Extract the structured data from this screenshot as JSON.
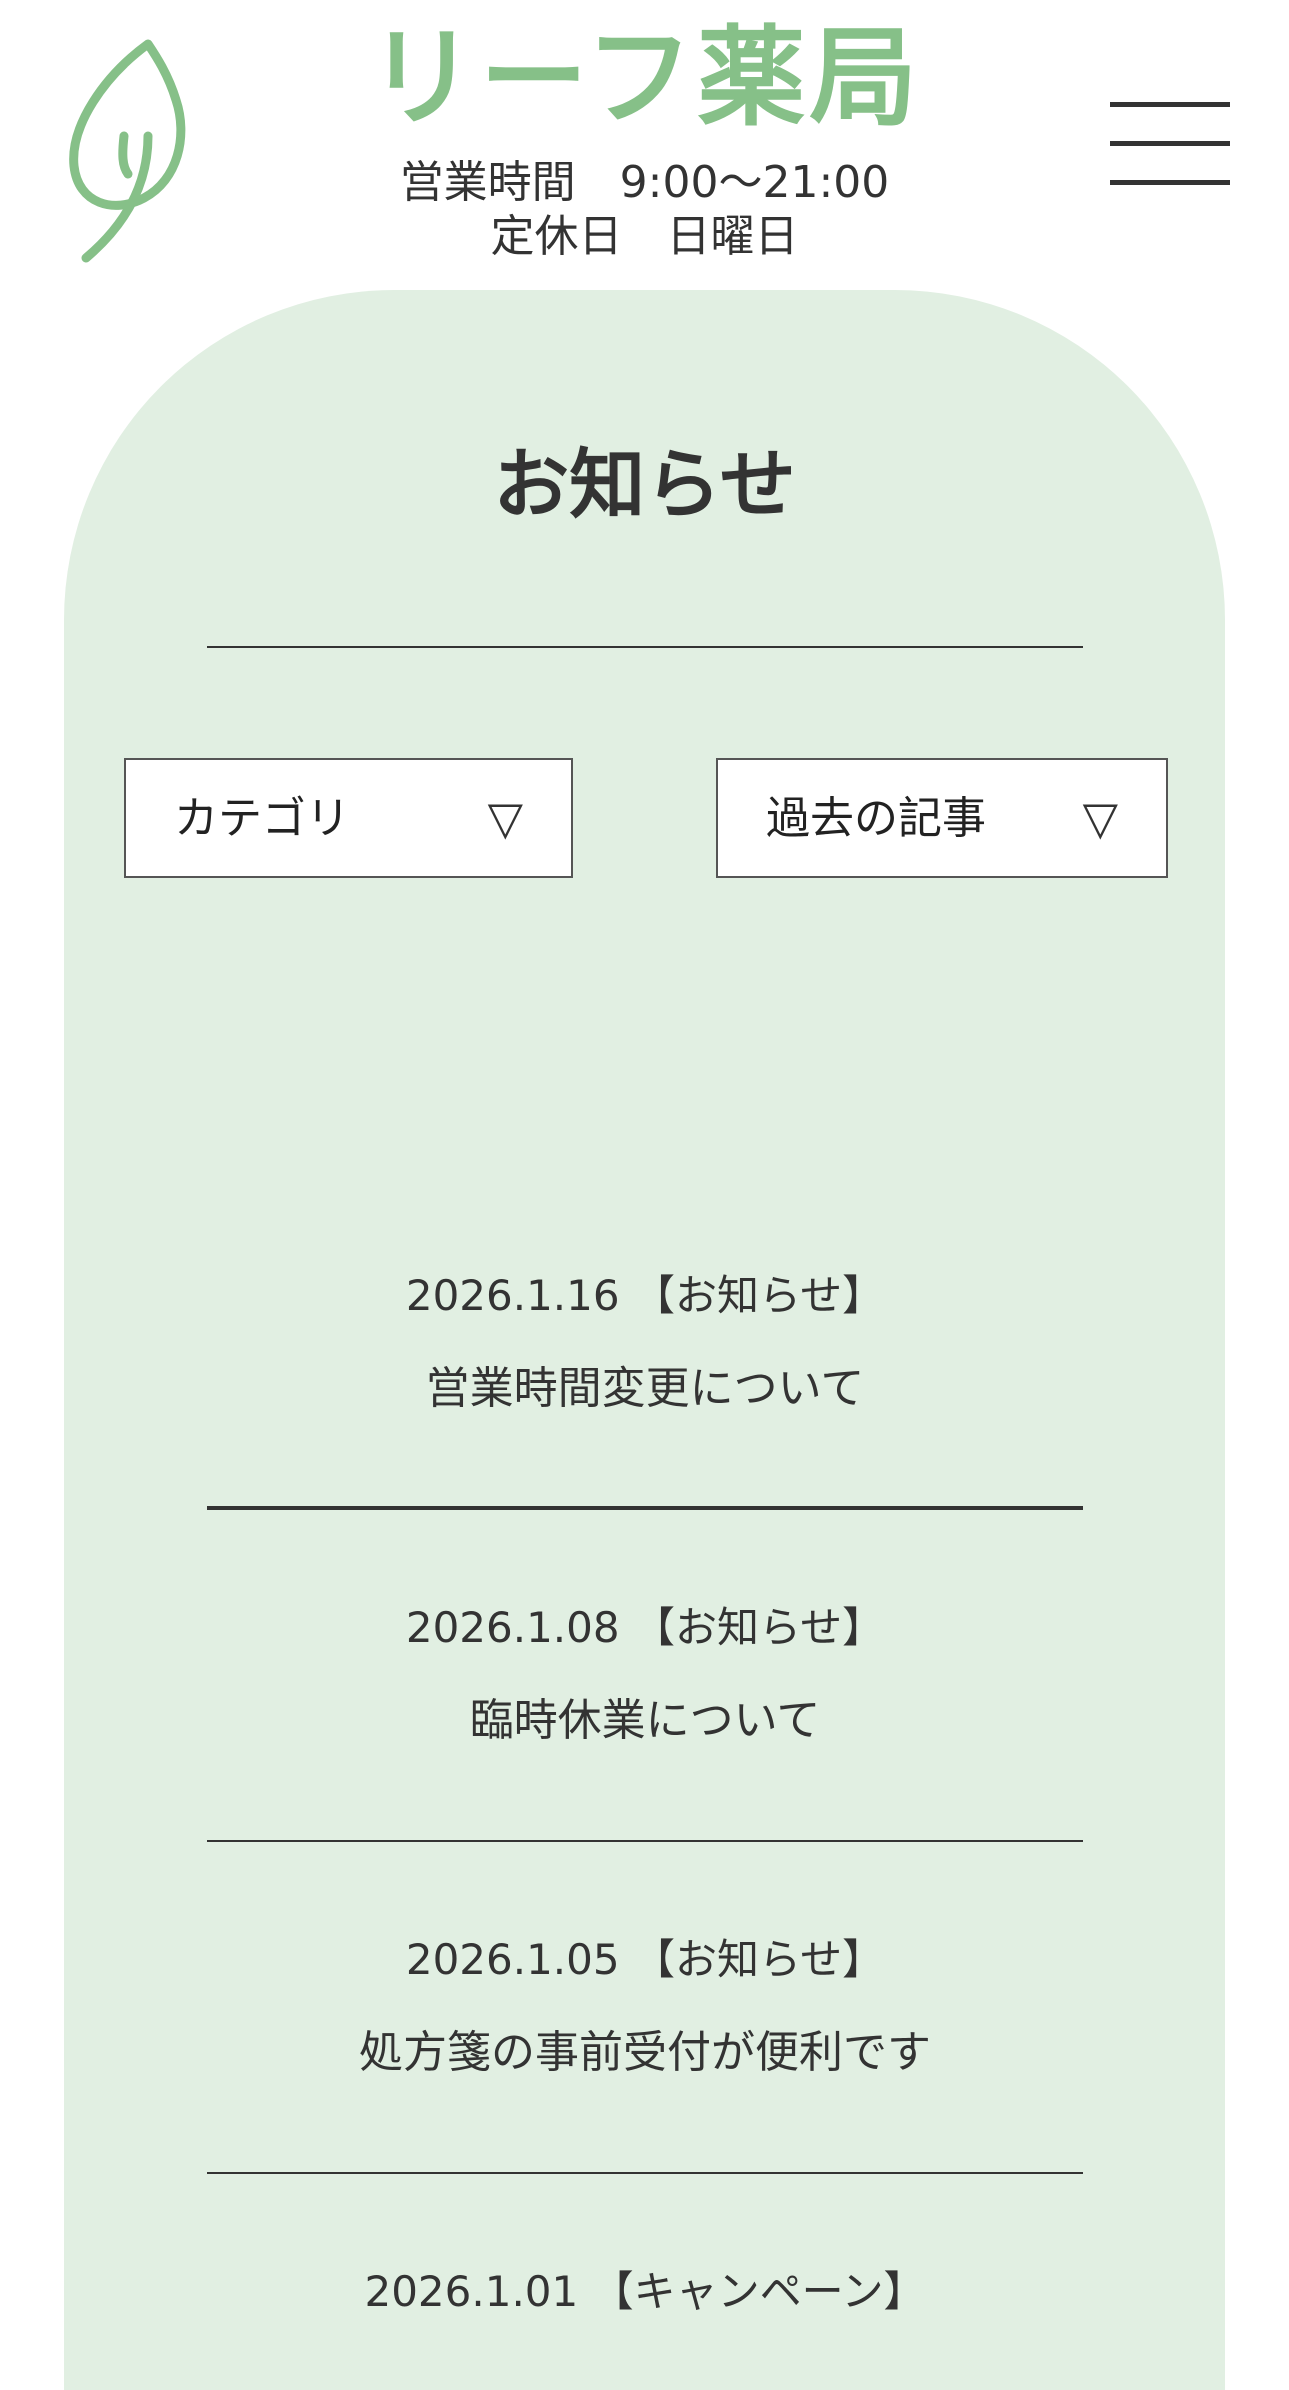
{
  "header": {
    "shop_name": "リーフ薬局",
    "hours_line": "営業時間　9:00〜21:00",
    "closed_line": "定休日　日曜日",
    "logo_icon": "leaf-icon",
    "menu_icon": "hamburger-menu-icon"
  },
  "colors": {
    "brand_green": "#86c088",
    "panel_background": "#e1efe2",
    "text": "#333333"
  },
  "main": {
    "title": "お知らせ",
    "filters": {
      "category_label": "カテゴリ",
      "archive_label": "過去の記事",
      "caret": "▽"
    },
    "news": [
      {
        "date": "2026.1.16",
        "tag": "【お知らせ】",
        "title": "営業時間変更について"
      },
      {
        "date": "2026.1.08",
        "tag": "【お知らせ】",
        "title": "臨時休業について"
      },
      {
        "date": "2026.1.05",
        "tag": "【お知らせ】",
        "title": "処方箋の事前受付が便利です"
      },
      {
        "date": "2026.1.01",
        "tag": "【キャンペーン】",
        "title": ""
      }
    ]
  }
}
